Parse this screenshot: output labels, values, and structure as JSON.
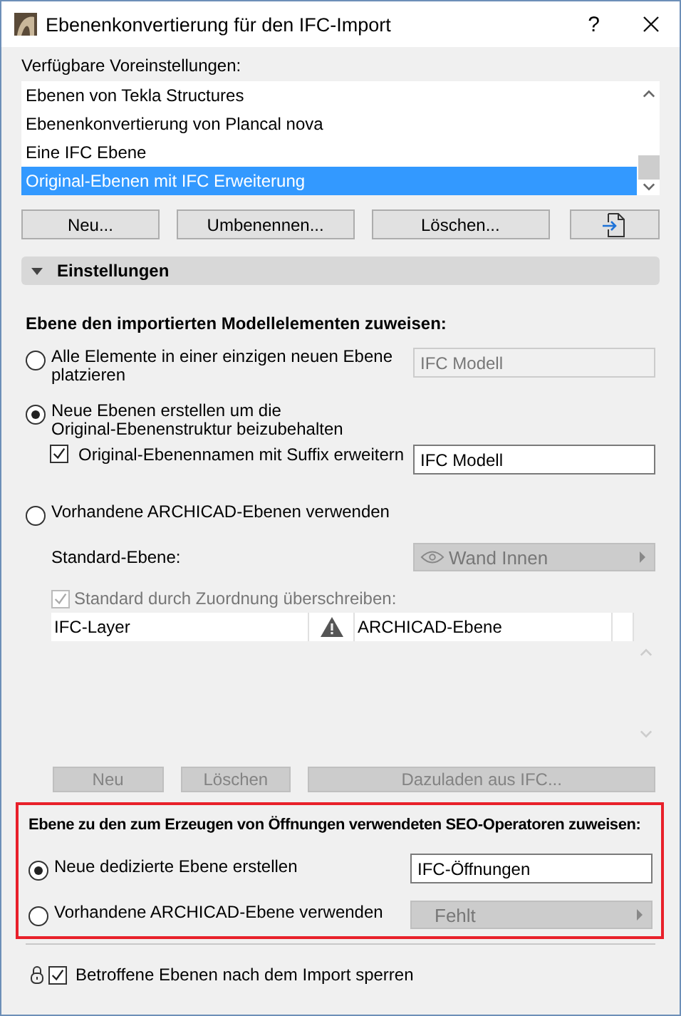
{
  "window": {
    "title": "Ebenenkonvertierung für den IFC-Import",
    "help": "?"
  },
  "presets": {
    "label": "Verfügbare Voreinstellungen:",
    "items": [
      {
        "label": "Ebenen von Tekla Structures",
        "selected": false
      },
      {
        "label": "Ebenenkonvertierung von Plancal nova",
        "selected": false
      },
      {
        "label": "Eine IFC Ebene",
        "selected": false
      },
      {
        "label": "Original-Ebenen mit IFC Erweiterung",
        "selected": true
      }
    ]
  },
  "preset_buttons": [
    {
      "label": "Neu..."
    },
    {
      "label": "Umbenennen..."
    },
    {
      "label": "Löschen..."
    }
  ],
  "settings": {
    "label": "Einstellungen",
    "expanded": true
  },
  "model_layers": {
    "heading": "Ebene den importierten Modellelementen zuweisen:",
    "options": [
      {
        "kind": "field",
        "label": "Alle Elemente in einer einzigen neuen Ebene\nplatzieren",
        "selected": false,
        "field": {
          "value": "IFC Modell",
          "disabled": true
        }
      },
      {
        "kind": "suffix",
        "label": "Neue Ebenen erstellen um die\nOriginal-Ebenenstruktur beizubehalten",
        "selected": true,
        "checkbox": {
          "label": "Original-Ebenennamen mit Suffix erweitern",
          "checked": true
        },
        "field": {
          "value": "IFC Modell",
          "disabled": false
        }
      },
      {
        "kind": "plain",
        "label": "Vorhandene ARCHICAD-Ebenen verwenden",
        "selected": false
      }
    ]
  },
  "mapping": {
    "default_label": "Standard-Ebene:",
    "default_layer": {
      "value": "Wand Innen",
      "disabled": true
    },
    "override": {
      "label": "Standard durch Zuordnung überschreiben:",
      "checked": true,
      "disabled": true
    },
    "columns": [
      "IFC-Layer",
      "ARCHICAD-Ebene"
    ],
    "buttons": [
      {
        "label": "Neu",
        "disabled": true
      },
      {
        "label": "Löschen",
        "disabled": true
      },
      {
        "label": "Dazuladen aus IFC...",
        "disabled": true
      }
    ]
  },
  "openings": {
    "highlighted": true,
    "heading": "Ebene zu den zum Erzeugen von Öffnungen verwendeten SEO-Operatoren zuweisen:",
    "options": [
      {
        "kind": "field",
        "label": "Neue dedizierte Ebene erstellen",
        "selected": true,
        "field": {
          "value": "IFC-Öffnungen",
          "disabled": false
        }
      },
      {
        "kind": "dropdown",
        "label": "Vorhandene ARCHICAD-Ebene verwenden",
        "selected": false,
        "dropdown": {
          "value": "Fehlt",
          "disabled": true
        }
      }
    ]
  },
  "lock": {
    "label": "Betroffene Ebenen nach dem Import sperren",
    "checked": true
  }
}
